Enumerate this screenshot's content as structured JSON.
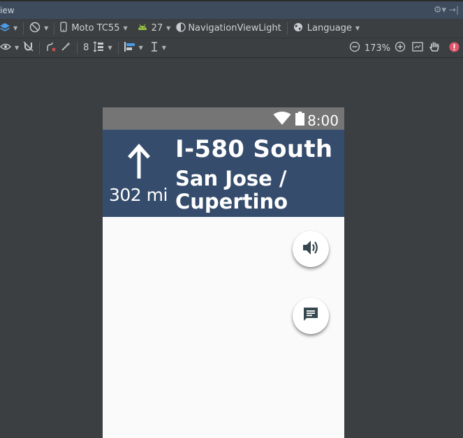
{
  "window": {
    "title": "iew"
  },
  "toolbar1": {
    "device": "Moto TC55",
    "api_level": "27",
    "theme": "NavigationViewLight",
    "language": "Language"
  },
  "toolbar2": {
    "margin_value": "8",
    "zoom": "173%"
  },
  "device_screen": {
    "status_time": "8:00",
    "distance": "302 mi",
    "road_name": "I-580 South",
    "destination": "San Jose / Cupertino"
  },
  "colors": {
    "nav_header": "#354c6c",
    "status_bar": "#757575",
    "canvas": "#3b3f42",
    "fab_icon": "#37474f"
  },
  "icons": {
    "sound": "volume-icon",
    "chat": "message-icon",
    "direction": "arrow-up-icon"
  }
}
